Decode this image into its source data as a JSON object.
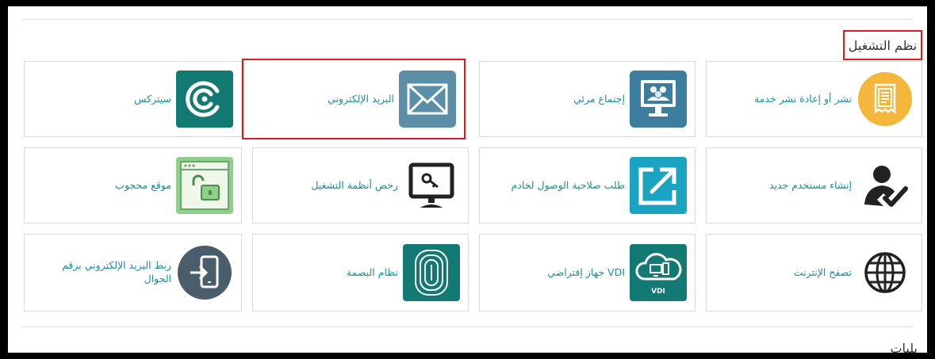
{
  "section": {
    "title": "نظم التشغيل",
    "next_title": "بلبات"
  },
  "tiles": [
    {
      "label": "نشر أو إعادة نشر خدمة",
      "icon": "receipt-icon"
    },
    {
      "label": "إجتماع مرئي",
      "icon": "video-meeting-icon"
    },
    {
      "label": "البريد الإلكتروني",
      "icon": "envelope-icon"
    },
    {
      "label": "سيتركس",
      "icon": "citrix-icon"
    },
    {
      "label": "إنشاء مستخدم جديد",
      "icon": "user-check-icon"
    },
    {
      "label": "طلب صلاحية الوصول لخادم",
      "icon": "external-link-icon"
    },
    {
      "label": "رخص أنظمة التشغيل",
      "icon": "monitor-key-icon"
    },
    {
      "label": "موقع محجوب",
      "icon": "unlocked-browser-icon"
    },
    {
      "label": "تصفح الإنترنت",
      "icon": "globe-icon"
    },
    {
      "label": "VDI جهاز إفتراضي",
      "icon": "vdi-cloud-icon",
      "icon_text": "VDI"
    },
    {
      "label": "نظام البصمة",
      "icon": "fingerprint-icon"
    },
    {
      "label": "ربط البريد الإلكتروني برقم الجوال",
      "icon": "phone-link-icon"
    }
  ],
  "colors": {
    "label": "#1a8f9a",
    "highlight_border": "#e01b1b",
    "receipt_bg": "#f4b73c",
    "meeting_bg": "#3d7ea0",
    "mail_bg": "#5b8fa8",
    "citrix_bg": "#127a72",
    "link_bg": "#1aa4c2",
    "browser_bg": "#8fcf8c",
    "vdi_bg": "#127a72",
    "fingerprint_bg": "#127a72",
    "phone_bg": "#495d6b"
  }
}
